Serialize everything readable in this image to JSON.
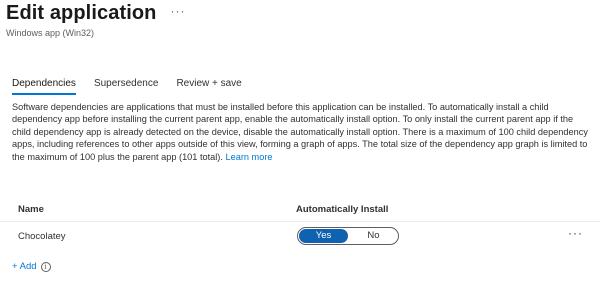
{
  "header": {
    "title": "Edit application",
    "more_icon": "more-horizontal-icon",
    "more_glyph": "···",
    "subtitle": "Windows app (Win32)"
  },
  "tabs": [
    {
      "label": "Dependencies",
      "active": true
    },
    {
      "label": "Supersedence",
      "active": false
    },
    {
      "label": "Review + save",
      "active": false
    }
  ],
  "description": {
    "text": "Software dependencies are applications that must be installed before this application can be installed. To automatically install a child dependency app before installing the current parent app, enable the automatically install option. To only install the current parent app if the child dependency app is already detected on the device, disable the automatically install option. There is a maximum of 100 child dependency apps, including references to other apps outside of this view, forming a graph of apps. The total size of the dependency app graph is limited to the maximum of 100 plus the parent app (101 total).",
    "link": "Learn more"
  },
  "table": {
    "headers": {
      "name": "Name",
      "auto_install": "Automatically Install"
    },
    "rows": [
      {
        "name": "Chocolatey",
        "auto_install_yes": "Yes",
        "auto_install_no": "No",
        "selected": "Yes",
        "more_glyph": "···"
      }
    ]
  },
  "add": {
    "label": "+ Add",
    "info_glyph": "i"
  },
  "colors": {
    "accent": "#0078d4",
    "toggle_selected": "#0f62b0"
  }
}
